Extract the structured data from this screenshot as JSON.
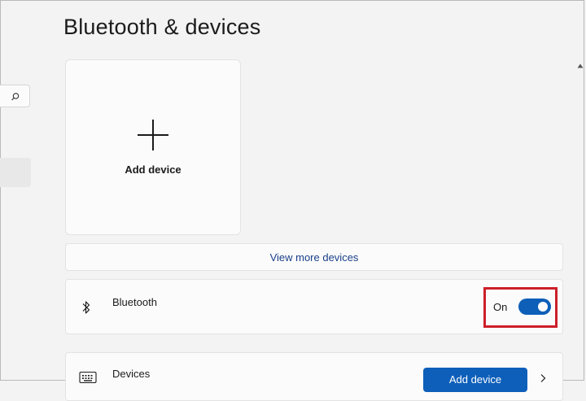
{
  "page": {
    "title": "Bluetooth & devices"
  },
  "sidebar": {
    "search_icon": "search-icon"
  },
  "add_device_card": {
    "label": "Add device",
    "icon": "plus-icon"
  },
  "view_more": {
    "label": "View more devices"
  },
  "bluetooth": {
    "label": "Bluetooth",
    "icon": "bluetooth-icon",
    "state_label": "On",
    "enabled": true
  },
  "devices": {
    "label": "Devices",
    "icon": "keyboard-icon",
    "button_label": "Add device",
    "chevron_icon": "chevron-right-icon"
  },
  "colors": {
    "accent": "#0e5fba",
    "highlight": "#cc1f2a",
    "background": "#f3f3f3",
    "card": "#fbfbfb"
  }
}
